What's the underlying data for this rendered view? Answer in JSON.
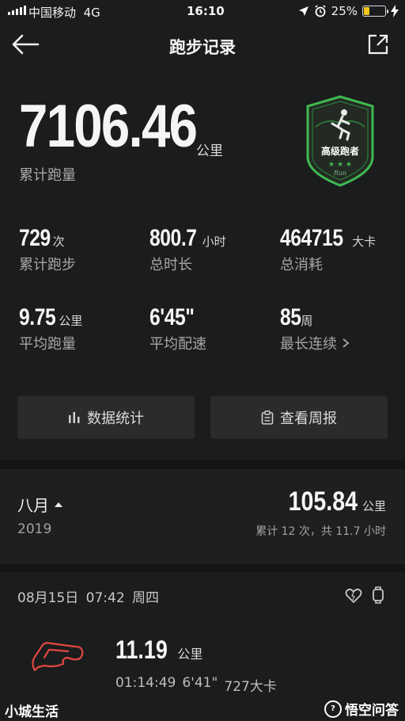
{
  "status_bar": {
    "carrier": "中国移动",
    "network": "4G",
    "time": "16:10",
    "battery": "25%",
    "battery_level": 0.25
  },
  "nav": {
    "title": "跑步记录",
    "back_icon": "back-arrow-icon",
    "share_icon": "share-icon"
  },
  "hero": {
    "distance": "7106.46",
    "unit": "公里",
    "label": "累计跑量"
  },
  "badge": {
    "title": "高级跑者",
    "sub": "Run",
    "stars": 3
  },
  "stats": [
    {
      "value": "729",
      "unit": "次",
      "label": "累计跑步"
    },
    {
      "value": "800.7",
      "unit": "小时",
      "label": "总时长"
    },
    {
      "value": "464715",
      "unit": "大卡",
      "label": "总消耗"
    },
    {
      "value": "9.75",
      "unit": "公里",
      "label": "平均跑量"
    },
    {
      "value": "6'45\"",
      "unit": "",
      "label": "平均配速"
    },
    {
      "value": "85",
      "unit": "周",
      "label": "最长连续"
    }
  ],
  "buttons": {
    "stats": "数据统计",
    "weekly": "查看周报"
  },
  "month": {
    "name": "八月",
    "year": "2019",
    "distance": "105.84",
    "unit": "公里",
    "summary": "累计 12 次，共 11.7 小时"
  },
  "record": {
    "date": "08月15日 07:42 周四",
    "distance": "11.19",
    "unit": "公里",
    "duration": "01:14:49",
    "pace": "6'41\"",
    "calories": "727大卡"
  },
  "watermark": {
    "left": "小城生活",
    "right": "悟空问答"
  },
  "colors": {
    "background": "#1b1c1e",
    "card": "#2a2b2d",
    "badge_green": "#3fb950",
    "route_red": "#e0483e"
  }
}
